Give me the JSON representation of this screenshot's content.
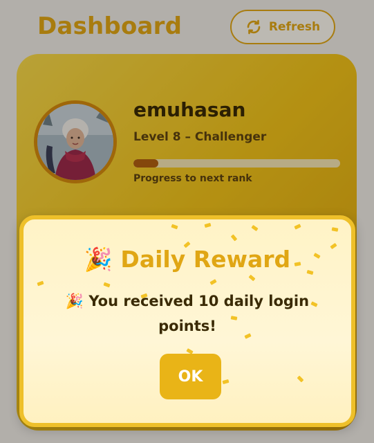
{
  "header": {
    "title": "Dashboard",
    "refresh_label": "Refresh",
    "refresh_icon": "refresh-icon"
  },
  "profile": {
    "username": "emuhasan",
    "level": "Level 8 – Challenger",
    "progress_fraction": 0.12,
    "progress_caption": "Progress to next rank",
    "avatar": "avatar-photo"
  },
  "modal": {
    "emoji": "🎉",
    "title": "Daily Reward",
    "message_emoji": "🎉",
    "message": "You received 10 daily login points!",
    "ok_label": "OK"
  },
  "colors": {
    "accent": "#e0a614",
    "card_gradient_start": "#f7d84a",
    "card_gradient_end": "#d9a10d",
    "progress_fill": "#b15f10",
    "ok_button": "#e9b417",
    "text_dark": "#3a2a05"
  }
}
